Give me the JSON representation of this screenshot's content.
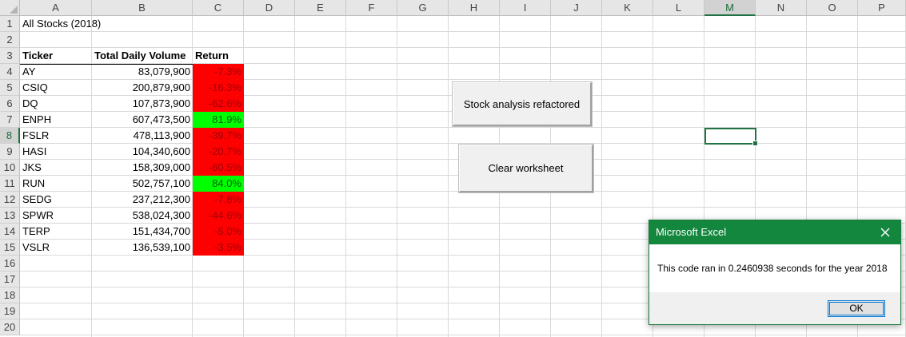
{
  "columns": [
    "A",
    "B",
    "C",
    "D",
    "E",
    "F",
    "G",
    "H",
    "I",
    "J",
    "K",
    "L",
    "M",
    "N",
    "O",
    "P"
  ],
  "active_column": "M",
  "rows": [
    "1",
    "2",
    "3",
    "4",
    "5",
    "6",
    "7",
    "8",
    "9",
    "10",
    "11",
    "12",
    "13",
    "14",
    "15",
    "16",
    "17",
    "18",
    "19",
    "20"
  ],
  "active_row": "8",
  "sheet": {
    "title": "All Stocks (2018)",
    "headers": {
      "ticker": "Ticker",
      "volume": "Total Daily Volume",
      "return": "Return"
    },
    "stocks": [
      {
        "ticker": "AY",
        "volume": "83,079,900",
        "return": "-7.3%",
        "positive": false
      },
      {
        "ticker": "CSIQ",
        "volume": "200,879,900",
        "return": "-16.3%",
        "positive": false
      },
      {
        "ticker": "DQ",
        "volume": "107,873,900",
        "return": "-62.6%",
        "positive": false
      },
      {
        "ticker": "ENPH",
        "volume": "607,473,500",
        "return": "81.9%",
        "positive": true
      },
      {
        "ticker": "FSLR",
        "volume": "478,113,900",
        "return": "-39.7%",
        "positive": false
      },
      {
        "ticker": "HASI",
        "volume": "104,340,600",
        "return": "-20.7%",
        "positive": false
      },
      {
        "ticker": "JKS",
        "volume": "158,309,000",
        "return": "-60.5%",
        "positive": false
      },
      {
        "ticker": "RUN",
        "volume": "502,757,100",
        "return": "84.0%",
        "positive": true
      },
      {
        "ticker": "SEDG",
        "volume": "237,212,300",
        "return": "-7.8%",
        "positive": false
      },
      {
        "ticker": "SPWR",
        "volume": "538,024,300",
        "return": "-44.6%",
        "positive": false
      },
      {
        "ticker": "TERP",
        "volume": "151,434,700",
        "return": "-5.0%",
        "positive": false
      },
      {
        "ticker": "VSLR",
        "volume": "136,539,100",
        "return": "-3.5%",
        "positive": false
      }
    ]
  },
  "buttons": {
    "refactored": "Stock analysis refactored",
    "clear": "Clear worksheet"
  },
  "dialog": {
    "title": "Microsoft Excel",
    "message": "This code ran in 0.2460938 seconds for the year 2018",
    "ok": "OK"
  },
  "colors": {
    "negative_fill": "#ff0000",
    "positive_fill": "#00ff00",
    "excel_green": "#217346",
    "dialog_title_bar": "#13873e"
  },
  "icons": {
    "close": "close-icon",
    "select_all": "select-all-triangle-icon"
  }
}
